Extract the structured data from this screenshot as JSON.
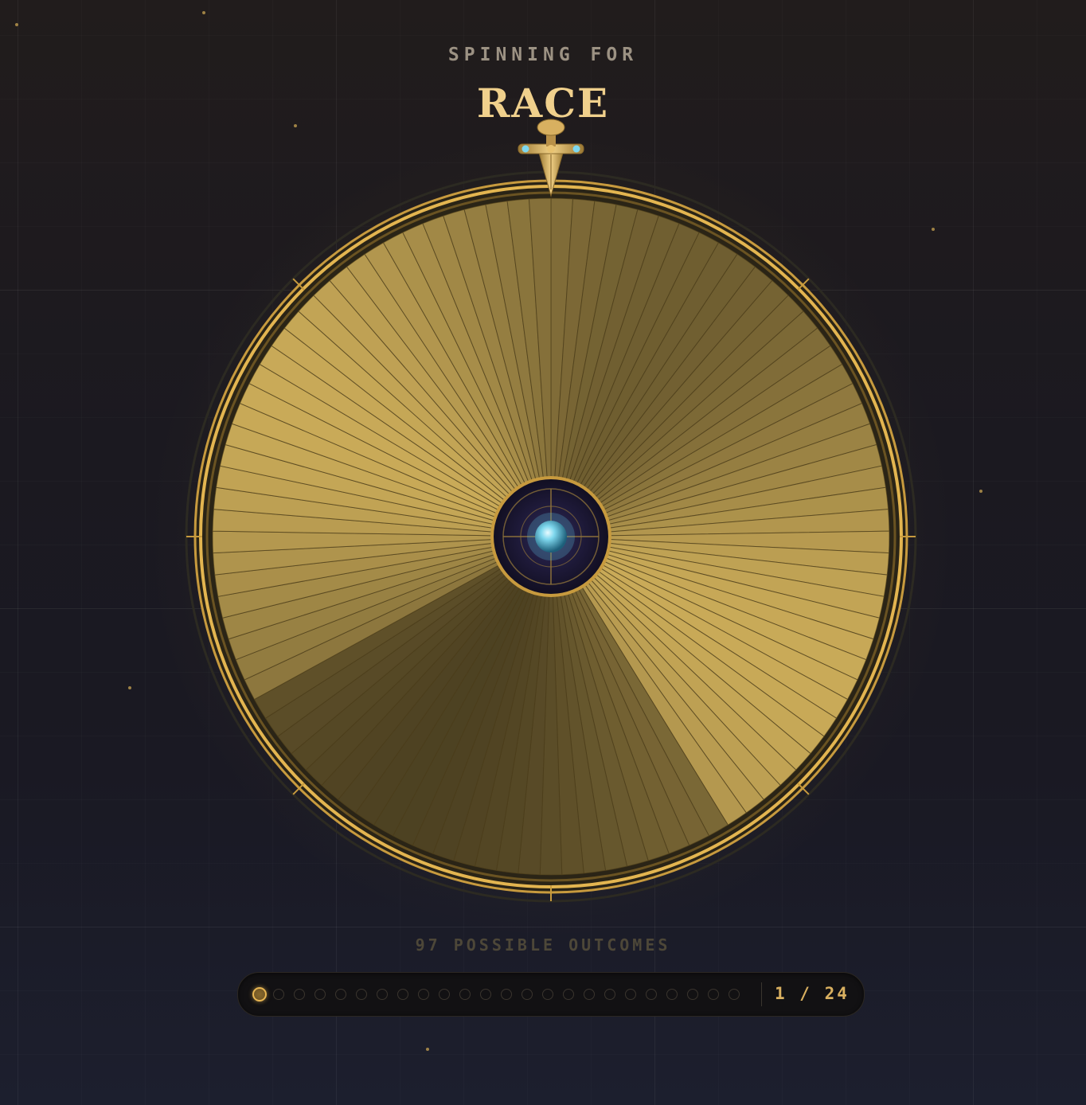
{
  "header": {
    "subtitle": "SPINNING FOR",
    "title": "RACE"
  },
  "wheel": {
    "segment_count": 97,
    "colors": {
      "gold_light": "#c9aa58",
      "gold_mid": "#a48a3f",
      "gold_dark": "#5e4c22",
      "rim": "#e0b550",
      "hub_dark": "#1a1530",
      "gem": "#7fd8ee"
    },
    "pointer_icon": "sword-pointer-icon",
    "hub_icon": "crosshair-gem-icon"
  },
  "footer": {
    "outcomes_label": "97 POSSIBLE OUTCOMES",
    "progress": {
      "current": 1,
      "total": 24,
      "counter_text": "1 / 24"
    }
  }
}
